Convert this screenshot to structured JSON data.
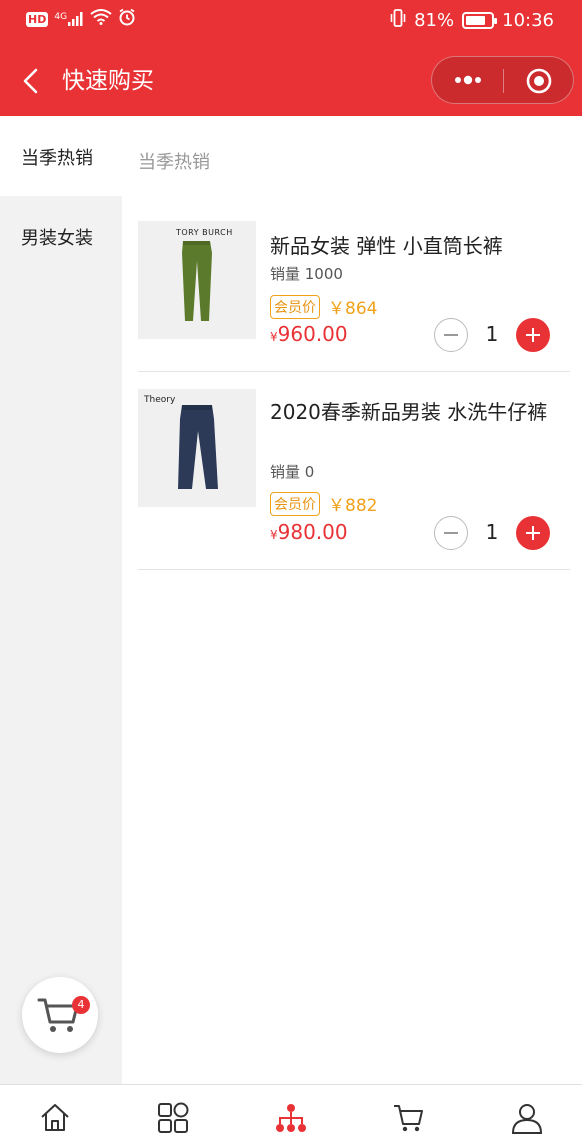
{
  "status_bar": {
    "hd_label": "HD",
    "network_label": "4G",
    "battery_percent": "81%",
    "battery_level": 0.81,
    "time": "10:36"
  },
  "nav": {
    "title": "快速购买",
    "back_icon": "chevron-left-icon",
    "more_icon": "more-dots-icon",
    "close_icon": "target-icon"
  },
  "sidebar": {
    "items": [
      {
        "label": "当季热销",
        "active": true
      },
      {
        "label": "男装女装",
        "active": false
      }
    ]
  },
  "section_title": "当季热销",
  "products": [
    {
      "brand_text": "TORY BURCH",
      "name": "新品女装 弹性 小直筒长裤",
      "sales": "销量 1000",
      "member_tag": "会员价",
      "member_price": "￥864",
      "yen": "¥",
      "price": "960.00",
      "quantity": "1",
      "image_color": "#5b7a2c"
    },
    {
      "brand_text": "Theory",
      "name": "2020春季新品男装 水洗牛仔裤",
      "sales": "销量 0",
      "member_tag": "会员价",
      "member_price": "￥882",
      "yen": "¥",
      "price": "980.00",
      "quantity": "1",
      "image_color": "#2c3a58"
    }
  ],
  "cart": {
    "icon": "cart-icon",
    "badge_count": "4"
  },
  "tabbar": {
    "tabs": [
      {
        "icon": "home-icon",
        "active": false
      },
      {
        "icon": "category-icon",
        "active": false
      },
      {
        "icon": "distribution-icon",
        "active": true
      },
      {
        "icon": "cart-icon",
        "active": false
      },
      {
        "icon": "user-icon",
        "active": false
      }
    ]
  },
  "colors": {
    "brand_red": "#e93235",
    "member_orange": "#f0a21a",
    "sidebar_bg": "#f2f2f2"
  }
}
